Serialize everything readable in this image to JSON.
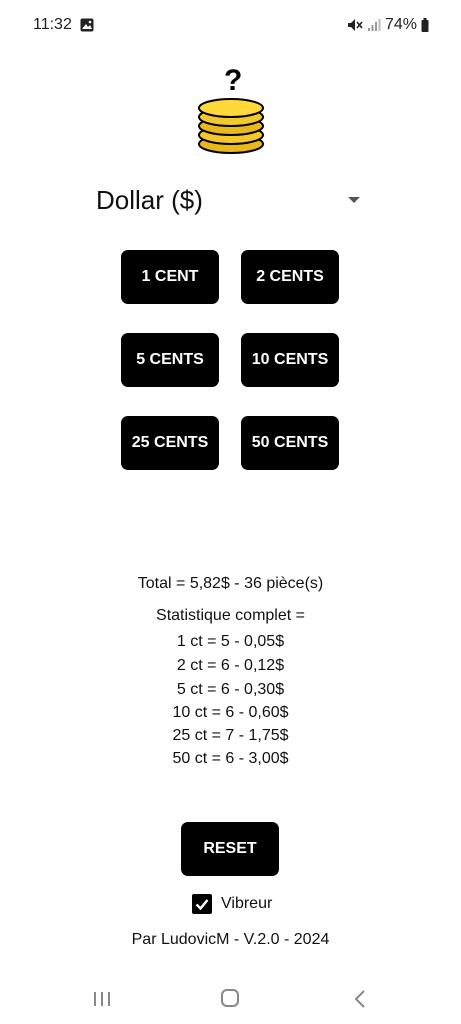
{
  "status_bar": {
    "time": "11:32",
    "battery": "74%",
    "icons": [
      "gallery-icon",
      "mute-icon",
      "signal-icon",
      "battery-icon"
    ]
  },
  "app": {
    "logo_icon": "coin-stack-question-icon",
    "currency_select": {
      "value": "Dollar ($)"
    },
    "coin_buttons": [
      "1 CENT",
      "2 CENTS",
      "5 CENTS",
      "10 CENTS",
      "25 CENTS",
      "50 CENTS"
    ],
    "total": "Total = 5,82$ - 36 pièce(s)",
    "stats_title": "Statistique complet =",
    "stats_lines": [
      "1 ct = 5 - 0,05$",
      "2 ct = 6 - 0,12$",
      "5 ct = 6 - 0,30$",
      "10 ct = 6 - 0,60$",
      "25 ct = 7 - 1,75$",
      "50 ct = 6 - 3,00$"
    ],
    "reset_label": "RESET",
    "vibrate": {
      "label": "Vibreur",
      "checked": true
    },
    "footer": "Par LudovicM - V.2.0 - 2024"
  },
  "colors": {
    "button_bg": "#000000",
    "button_text": "#ffffff",
    "coin_gold": "#f3c82a"
  }
}
